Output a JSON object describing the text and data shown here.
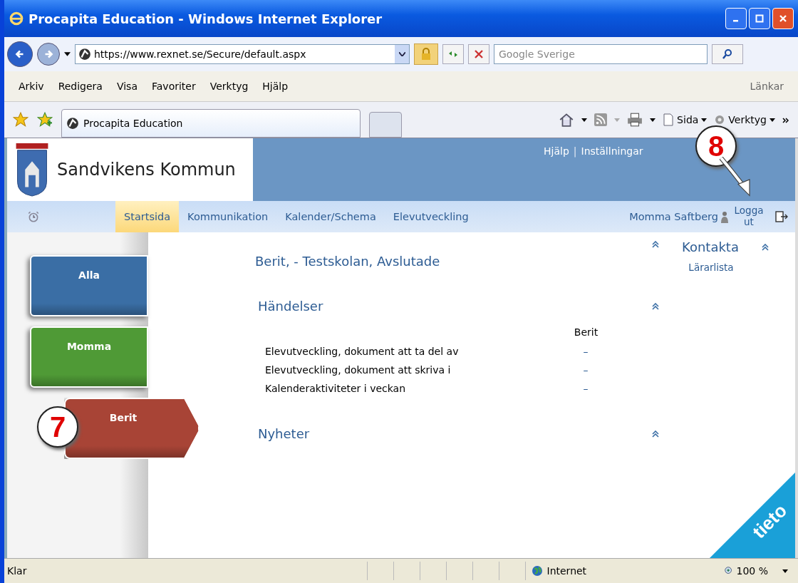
{
  "window": {
    "title": "Procapita Education - Windows Internet Explorer"
  },
  "address_bar": {
    "url": "https://www.rexnet.se/Secure/default.aspx",
    "search_placeholder": "Google Sverige"
  },
  "menu_bar": {
    "items": [
      "Arkiv",
      "Redigera",
      "Visa",
      "Favoriter",
      "Verktyg",
      "Hjälp"
    ],
    "links": "Länkar"
  },
  "tabs": [
    {
      "label": "Procapita Education",
      "selected": true
    }
  ],
  "command_bar": {
    "page": "Sida",
    "tools": "Verktyg"
  },
  "site": {
    "name": "Sandvikens Kommun",
    "top_links": [
      "Hjälp",
      "Inställningar"
    ],
    "link_separator": "|",
    "nav": [
      {
        "label": "Startsida",
        "selected": true
      },
      {
        "label": "Kommunikation",
        "selected": false
      },
      {
        "label": "Kalender/Schema",
        "selected": false
      },
      {
        "label": "Elevutveckling",
        "selected": false
      }
    ],
    "user": "Momma Saftberg",
    "logout": "Logga ut"
  },
  "sidebar": {
    "items": [
      {
        "label": "Alla",
        "color": "#3a6ea5",
        "selected": false
      },
      {
        "label": "Momma",
        "color": "#4f9a36",
        "selected": false
      },
      {
        "label": "Berit",
        "color": "#a84436",
        "selected": true
      }
    ]
  },
  "main": {
    "heading": "Berit, - Testskolan, Avslutade",
    "events": {
      "title": "Händelser",
      "column": "Berit",
      "rows": [
        {
          "label": "Elevutveckling, dokument att ta del av",
          "value": "–"
        },
        {
          "label": "Elevutveckling, dokument att skriva i",
          "value": "–"
        },
        {
          "label": "Kalenderaktiviteter i veckan",
          "value": "–"
        }
      ]
    },
    "news": {
      "title": "Nyheter"
    }
  },
  "contact": {
    "title": "Kontakta",
    "link": "Lärarlista"
  },
  "brand": "tieto",
  "callouts": [
    "7",
    "8"
  ],
  "status_bar": {
    "text": "Klar",
    "zone": "Internet",
    "zoom": "100 %"
  }
}
